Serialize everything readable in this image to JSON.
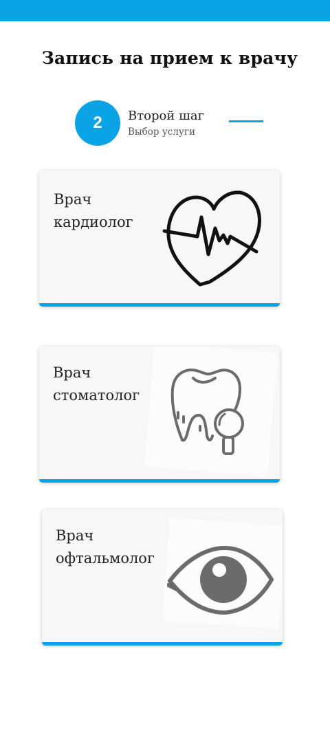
{
  "header": {
    "title": "Запись на прием к врачу"
  },
  "step": {
    "number": "2",
    "title": "Второй шаг",
    "subtitle": "Выбор услуги"
  },
  "services": [
    {
      "line1": "Врач",
      "line2": "кардиолог",
      "icon": "heart-pulse-icon"
    },
    {
      "line1": "Врач",
      "line2": "стоматолог",
      "icon": "tooth-magnifier-icon"
    },
    {
      "line1": "Врач",
      "line2": "офтальмолог",
      "icon": "eye-icon"
    }
  ],
  "colors": {
    "accent": "#0aa3e6",
    "card_bg": "#f7f7f7",
    "text": "#222222",
    "icon_gray": "#6b6b6b"
  }
}
